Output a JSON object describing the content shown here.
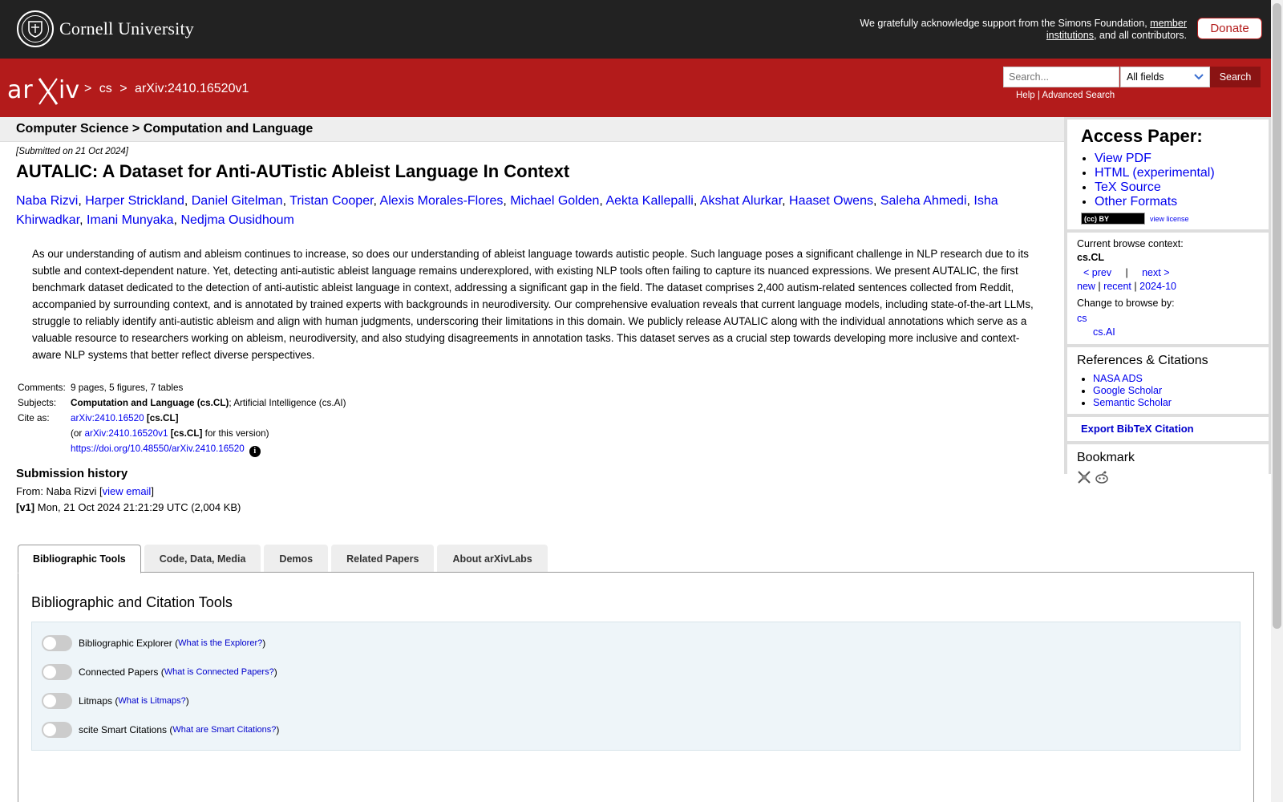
{
  "cornell": {
    "name": "Cornell University",
    "support_text": "We gratefully acknowledge support from the Simons Foundation,",
    "support_link": "member institutions",
    "support_tail": ", and all contributors.",
    "donate_label": "Donate"
  },
  "arxiv": {
    "crumb_cs": "cs",
    "crumb_sep": ">",
    "crumb_id": "arXiv:2410.16520v1",
    "search_placeholder": "Search...",
    "search_field": "All fields",
    "search_button": "Search",
    "help_link": "Help",
    "advanced_link": "Advanced Search",
    "link_sep": "|"
  },
  "subheader": "Computer Science > Computation and Language",
  "paper": {
    "submitted": "[Submitted on 21 Oct 2024]",
    "title": "AUTALIC: A Dataset for Anti-AUTistic Ableist Language In Context",
    "authors": [
      "Naba Rizvi",
      "Harper Strickland",
      "Daniel Gitelman",
      "Tristan Cooper",
      "Alexis Morales-Flores",
      "Michael Golden",
      "Aekta Kallepalli",
      "Akshat Alurkar",
      "Haaset Owens",
      "Saleha Ahmedi",
      "Isha Khirwadkar",
      "Imani Munyaka",
      "Nedjma Ousidhoum"
    ],
    "abstract": "As our understanding of autism and ableism continues to increase, so does our understanding of ableist language towards autistic people. Such language poses a significant challenge in NLP research due to its subtle and context-dependent nature. Yet, detecting anti-autistic ableist language remains underexplored, with existing NLP tools often failing to capture its nuanced expressions. We present AUTALIC, the first benchmark dataset dedicated to the detection of anti-autistic ableist language in context, addressing a significant gap in the field. The dataset comprises 2,400 autism-related sentences collected from Reddit, accompanied by surrounding context, and is annotated by trained experts with backgrounds in neurodiversity. Our comprehensive evaluation reveals that current language models, including state-of-the-art LLMs, struggle to reliably identify anti-autistic ableism and align with human judgments, underscoring their limitations in this domain. We publicly release AUTALIC along with the individual annotations which serve as a valuable resource to researchers working on ableism, neurodiversity, and also studying disagreements in annotation tasks. This dataset serves as a crucial step towards developing more inclusive and context-aware NLP systems that better reflect diverse perspectives.",
    "comments_label": "Comments:",
    "comments": "9 pages, 5 figures, 7 tables",
    "subjects_label": "Subjects:",
    "subject_primary": "Computation and Language (cs.CL)",
    "subject_rest": "; Artificial Intelligence (cs.AI)",
    "cite_label": "Cite as:",
    "cite_id": "arXiv:2410.16520",
    "cite_cat": "[cs.CL]",
    "cite_or": "(or",
    "cite_version": "arXiv:2410.16520v1",
    "cite_version_cat": "[cs.CL]",
    "cite_version_tail": "for this version)",
    "doi": "https://doi.org/10.48550/arXiv.2410.16520",
    "info_icon": "i"
  },
  "history": {
    "title": "Submission history",
    "from_label": "From: Naba Rizvi [",
    "view_email": "view email",
    "from_close": "]",
    "v1_label": "[v1]",
    "v1_text": "Mon, 21 Oct 2024 21:21:29 UTC (2,004 KB)"
  },
  "tabs": [
    "Bibliographic Tools",
    "Code, Data, Media",
    "Demos",
    "Related Papers",
    "About arXivLabs"
  ],
  "tools": {
    "heading": "Bibliographic and Citation Tools",
    "items": [
      {
        "label": "Bibliographic Explorer",
        "help": "What is the Explorer?"
      },
      {
        "label": "Connected Papers",
        "help": "What is Connected Papers?"
      },
      {
        "label": "Litmaps",
        "help": "What is Litmaps?"
      },
      {
        "label": "scite Smart Citations",
        "help": "What are Smart Citations?"
      }
    ]
  },
  "sidebar": {
    "access_title": "Access Paper:",
    "access_links": [
      "View PDF",
      "HTML (experimental)",
      "TeX Source",
      "Other Formats"
    ],
    "license_badge": "(cc) BY",
    "view_license": "view license",
    "browse_context_label": "Current browse context:",
    "browse_context": "cs.CL",
    "prev": "< prev",
    "pipe": "|",
    "next": "next >",
    "new": "new",
    "recent": "recent",
    "month": "2024-10",
    "change_label": "Change to browse by:",
    "browse_cs": "cs",
    "browse_csai": "cs.AI",
    "refs_title": "References & Citations",
    "refs": [
      "NASA ADS",
      "Google Scholar",
      "Semantic Scholar"
    ],
    "export": "Export BibTeX Citation",
    "bookmark_title": "Bookmark"
  },
  "colors": {
    "arxiv_red": "#b31b1b",
    "cornell_dark": "#222222",
    "link_blue": "#0000ee"
  }
}
